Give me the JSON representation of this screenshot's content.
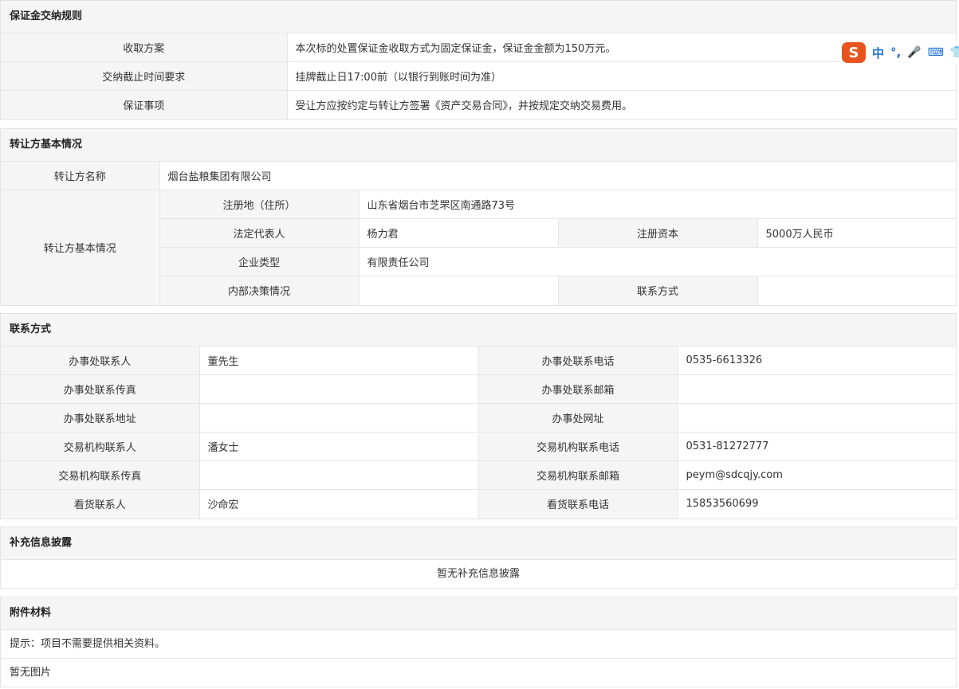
{
  "deposit": {
    "title": "保证金交纳规则",
    "rows": [
      {
        "label": "收取方案",
        "value": "本次标的处置保证金收取方式为固定保证金，保证金金额为150万元。"
      },
      {
        "label": "交纳截止时间要求",
        "value": "挂牌截止日17:00前（以银行到账时间为准）"
      },
      {
        "label": "保证事项",
        "value": "受让方应按约定与转让方签署《资产交易合同》，并按规定交纳交易费用。"
      }
    ]
  },
  "transferor": {
    "title": "转让方基本情况",
    "name_label": "转让方名称",
    "name_value": "烟台盐粮集团有限公司",
    "basic_label": "转让方基本情况",
    "reg_label": "注册地（住所）",
    "reg_value": "山东省烟台市芝罘区南通路73号",
    "legal_label": "法定代表人",
    "legal_value": "杨力君",
    "capital_label": "注册资本",
    "capital_value": "5000万人民币",
    "type_label": "企业类型",
    "type_value": "有限责任公司",
    "decision_label": "内部决策情况",
    "decision_value": "",
    "contact_label": "联系方式",
    "contact_value": ""
  },
  "contact": {
    "title": "联系方式",
    "rows": [
      {
        "l1": "办事处联系人",
        "v1": "董先生",
        "l2": "办事处联系电话",
        "v2": "0535-6613326"
      },
      {
        "l1": "办事处联系传真",
        "v1": "",
        "l2": "办事处联系邮箱",
        "v2": ""
      },
      {
        "l1": "办事处联系地址",
        "v1": "",
        "l2": "办事处网址",
        "v2": ""
      },
      {
        "l1": "交易机构联系人",
        "v1": "潘女士",
        "l2": "交易机构联系电话",
        "v2": "0531-81272777"
      },
      {
        "l1": "交易机构联系传真",
        "v1": "",
        "l2": "交易机构联系邮箱",
        "v2": "peym@sdcqjy.com"
      },
      {
        "l1": "看货联系人",
        "v1": "沙命宏",
        "l2": "看货联系电话",
        "v2": "15853560699"
      }
    ]
  },
  "supplement": {
    "title": "补充信息披露",
    "text": "暂无补充信息披露"
  },
  "attachments": {
    "title": "附件材料",
    "hint": "提示：项目不需要提供相关资料。",
    "no_image": "暂无图片"
  },
  "ime": {
    "logo": "S",
    "lang": "中",
    "punct": "°,",
    "mic": "🎤",
    "keyboard": "⌨",
    "more": "👕"
  }
}
